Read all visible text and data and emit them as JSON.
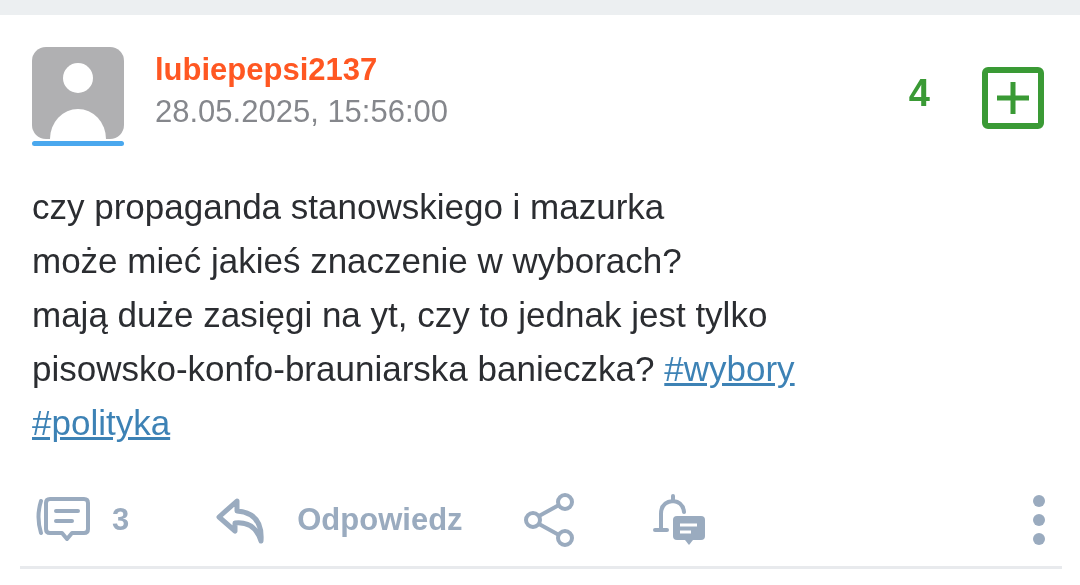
{
  "post": {
    "author": "lubiepepsi2137",
    "timestamp": "28.05.2025, 15:56:00",
    "score": "4",
    "body_lines": [
      {
        "text": "czy propaganda stanowskiego i mazurka"
      },
      {
        "text": "może mieć jakieś znaczenie w wyborach?"
      },
      {
        "text": "mają duże zasięgi na yt, czy to jednak jest tylko"
      },
      {
        "text": "pisowsko-konfo-brauniarska banieczka?",
        "tags": [
          "#wybory"
        ]
      },
      {
        "tags": [
          "#polityka"
        ]
      }
    ],
    "actions": {
      "comments": "3",
      "reply": "Odpowiedz"
    }
  }
}
